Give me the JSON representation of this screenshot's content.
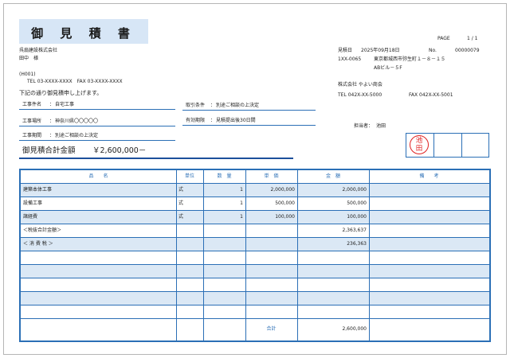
{
  "title": "御 見 積 書",
  "page_label": "PAGE",
  "page_value": "1 / 1",
  "client": {
    "company": "呉扇建設株式会社",
    "person": "田中　様",
    "code": "(H001)",
    "tel_fax": "TEL 03-XXXX-XXXX　FAX 03-XXXX-XXXX"
  },
  "estimate": {
    "date_label": "見積日",
    "date_value": "2025年09月18日",
    "no_label": "No.",
    "no_value": "00000079"
  },
  "vendor": {
    "postal": "1XX-0065",
    "address": "東京都城西市弥生町１－８－１５",
    "building": "ABビル－５F",
    "company": "株式会社 やよい商会",
    "tel": "TEL 042X-XX-5000",
    "fax": "FAX 042X-XX-5001",
    "staff_label": "担当者：",
    "staff_value": "池田"
  },
  "intro": "下記の通り御見積申し上げます。",
  "fields": {
    "work_name_label": "工事件名",
    "work_name_value": "自宅工事",
    "work_place_label": "工事場所",
    "work_place_value": "神奈川県〇〇〇〇〇",
    "work_period_label": "工事期間",
    "work_period_value": "別途ご相談の上決定",
    "terms_label": "取引条件",
    "terms_value": "別途ご相談の上決定",
    "valid_label": "有効期限",
    "valid_value": "見積提出後30日間"
  },
  "total_label": "御見積合計金額",
  "total_value": "￥2,600,000－",
  "stamp_text": "池田",
  "table": {
    "headers": [
      "品　　名",
      "単位",
      "数　量",
      "単　価",
      "金　額",
      "備　　考"
    ],
    "rows": [
      {
        "name": "建築本体工事",
        "unit": "式",
        "qty": "1",
        "price": "2,000,000",
        "amount": "2,000,000",
        "note": ""
      },
      {
        "name": "設備工事",
        "unit": "式",
        "qty": "1",
        "price": "500,000",
        "amount": "500,000",
        "note": ""
      },
      {
        "name": "諸経費",
        "unit": "式",
        "qty": "1",
        "price": "100,000",
        "amount": "100,000",
        "note": ""
      },
      {
        "name": "＜税抜合計金額＞",
        "unit": "",
        "qty": "",
        "price": "",
        "amount": "2,363,637",
        "note": ""
      },
      {
        "name": "＜ 消 費 税 ＞",
        "unit": "",
        "qty": "",
        "price": "",
        "amount": "236,363",
        "note": ""
      },
      {
        "name": "",
        "unit": "",
        "qty": "",
        "price": "",
        "amount": "",
        "note": ""
      },
      {
        "name": "",
        "unit": "",
        "qty": "",
        "price": "",
        "amount": "",
        "note": ""
      },
      {
        "name": "",
        "unit": "",
        "qty": "",
        "price": "",
        "amount": "",
        "note": ""
      },
      {
        "name": "",
        "unit": "",
        "qty": "",
        "price": "",
        "amount": "",
        "note": ""
      },
      {
        "name": "",
        "unit": "",
        "qty": "",
        "price": "",
        "amount": "",
        "note": ""
      }
    ],
    "footer_label": "合計",
    "footer_amount": "2,600,000"
  }
}
